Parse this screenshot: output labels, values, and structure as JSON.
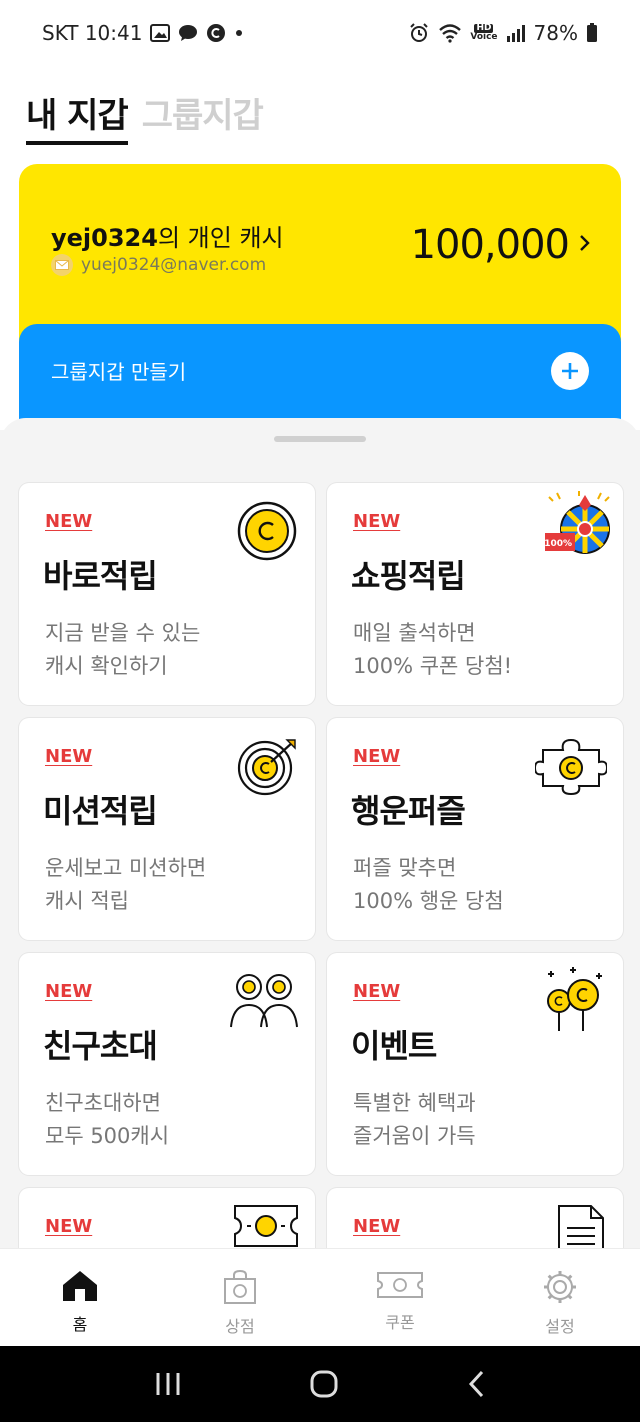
{
  "status_bar": {
    "carrier_time": "SKT 10:41",
    "battery": "78%",
    "hd_label": "HD",
    "voice_label": "Voice"
  },
  "header": {
    "tab_my_wallet": "내 지갑",
    "tab_group_wallet": "그룹지갑"
  },
  "wallet": {
    "owner_name": "yej0324",
    "owner_suffix": "의 개인 캐시",
    "email": "yuej0324@naver.com",
    "amount": "100,000"
  },
  "group_wallet": {
    "create_label": "그룹지갑 만들기"
  },
  "cards": [
    {
      "badge": "NEW",
      "title": "바로적립",
      "desc": "지금 받을 수 있는\n캐시 확인하기",
      "icon": "coin-icon"
    },
    {
      "badge": "NEW",
      "title": "쇼핑적립",
      "desc": "매일 출석하면\n100% 쿠폰 당첨!",
      "icon": "roulette-icon",
      "icon_badge": "100%"
    },
    {
      "badge": "NEW",
      "title": "미션적립",
      "desc": "운세보고 미션하면\n캐시 적립",
      "icon": "target-icon"
    },
    {
      "badge": "NEW",
      "title": "행운퍼즐",
      "desc": "퍼즐 맞추면\n100% 행운 당첨",
      "icon": "puzzle-icon"
    },
    {
      "badge": "NEW",
      "title": "친구초대",
      "desc": "친구초대하면\n모두 500캐시",
      "icon": "friends-icon"
    },
    {
      "badge": "NEW",
      "title": "이벤트",
      "desc": "특별한 혜택과\n즐거움이 가득",
      "icon": "balloon-icon"
    },
    {
      "badge": "NEW",
      "title": "",
      "desc": "",
      "icon": "ticket-icon"
    },
    {
      "badge": "NEW",
      "title": "",
      "desc": "",
      "icon": "document-icon"
    }
  ],
  "bottom_nav": {
    "home": "홈",
    "store": "상점",
    "coupon": "쿠폰",
    "settings": "설정"
  },
  "colors": {
    "wallet_yellow": "#ffe600",
    "group_blue": "#0a96ff",
    "new_red": "#e53b3b",
    "coin_yellow": "#ffd400"
  }
}
